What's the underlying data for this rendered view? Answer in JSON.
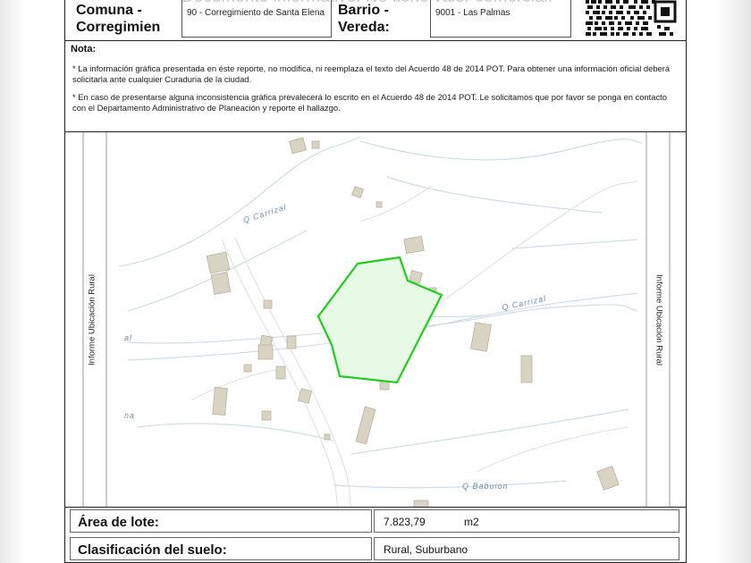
{
  "header": {
    "watermark": "Documento informativo. No tiene valor comercial.",
    "comuna_label": "Comuna - Corregimien",
    "comuna_value": "90 - Corregimiento de Santa Elena",
    "barrio_label": "Barrio - Vereda:",
    "barrio_value": "9001 - Las Palmas"
  },
  "nota": {
    "title": "Nota:",
    "p1": "* La información gráfica presentada en éste reporte, no  modifica, ni reemplaza el texto del Acuerdo 48 de 2014 POT. Para obtener una información oficial deberá solicitarla ante cualquier Curaduria de la ciudad.",
    "p2": "* En caso de presentarse alguna inconsistencia gráfica  prevalecerá lo escrito en el Acuerdo 48 de 2014 POT. Le solicitamos que por favor se ponga en contacto  con el Departamento Administrativo de Planeación y reporte el hallazgo."
  },
  "map": {
    "side_label_left": "Informe Ubicación Rural",
    "side_label_right": "Informe Ubicación Rural",
    "street_carrizal_1": "Q Carrizal",
    "street_carrizal_2": "Q Carrizal",
    "street_babuion": "Q Babuion",
    "fragment_al": "al",
    "fragment_na": "na",
    "lot_color": "#22cc22",
    "lot_fill": "#e6fae6"
  },
  "lote": {
    "area_label": "Área de lote:",
    "area_value": "7.823,79",
    "area_unit": "m2",
    "clasificacion_label": "Clasificación del suelo:",
    "clasificacion_value": "Rural, Suburbano"
  }
}
